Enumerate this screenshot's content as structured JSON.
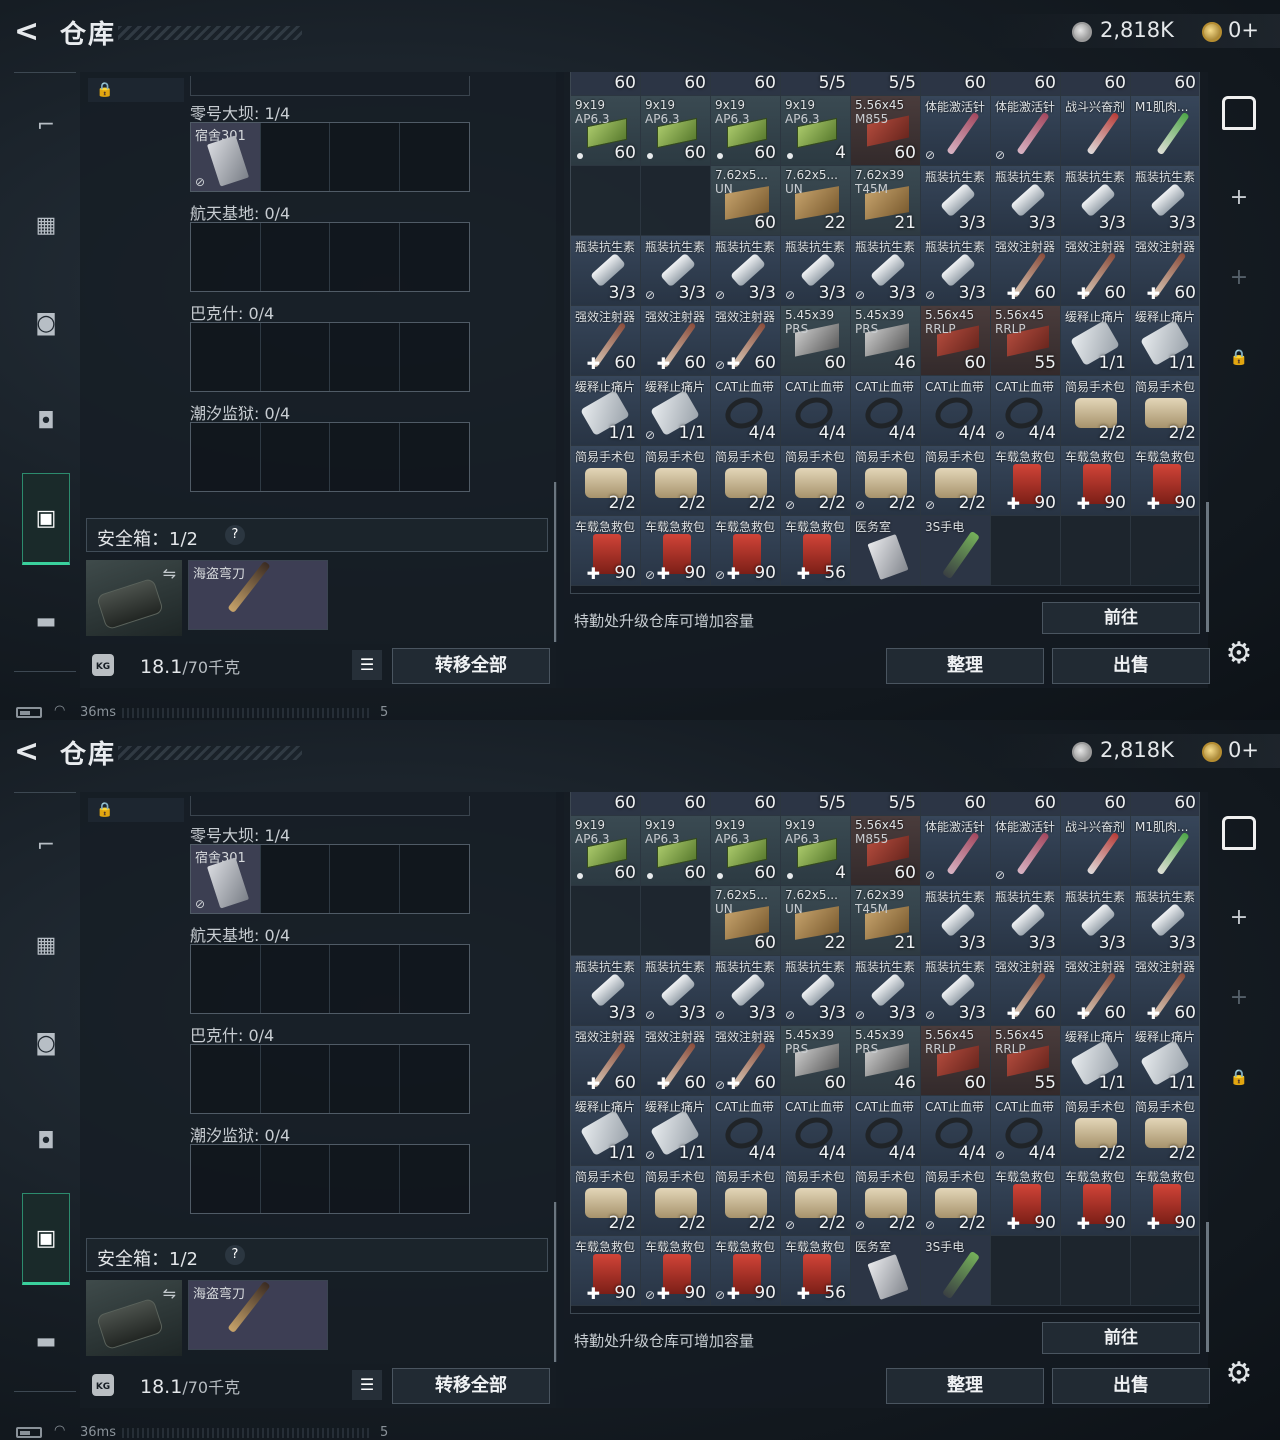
{
  "window": {
    "title": "仓库"
  },
  "currency": {
    "silver": "2,818K",
    "gold": "0+"
  },
  "nav_left": [
    {
      "icon": "pistol-icon",
      "glyph": "⌐"
    },
    {
      "icon": "vest-icon",
      "glyph": "▦"
    },
    {
      "icon": "backpack-icon",
      "glyph": "◙"
    },
    {
      "icon": "bag-icon",
      "glyph": "◘"
    },
    {
      "icon": "safebox-icon",
      "glyph": "▣"
    },
    {
      "icon": "briefcase-icon",
      "glyph": "▬"
    }
  ],
  "maps": [
    {
      "label": "零号大坝: 1/4",
      "items": [
        {
          "name": "宿舍301",
          "nosell": true
        }
      ]
    },
    {
      "label": "航天基地: 0/4",
      "items": []
    },
    {
      "label": "巴克什: 0/4",
      "items": []
    },
    {
      "label": "潮汐监狱: 0/4",
      "items": []
    }
  ],
  "safebox": {
    "title": "安全箱：1/2",
    "help": "?",
    "slot_item": "海盗弯刀"
  },
  "capacity": {
    "weight": "18.1",
    "max": "/70千克",
    "kg_label": "KG"
  },
  "actions": {
    "transfer_all": "转移全部",
    "goto": "前往",
    "sort": "整理",
    "sell": "出售",
    "list_icon": "☰"
  },
  "upgrade_hint": "特勤处升级仓库可增加容量",
  "status": {
    "ping": "36ms",
    "num": "5"
  },
  "stash_top_counts": [
    "60",
    "60",
    "60",
    "5/5",
    "5/5",
    "60",
    "60",
    "60",
    "60"
  ],
  "stash": [
    [
      {
        "n": "9x19",
        "s": "AP6.3",
        "c": "60",
        "t": "ammo-green",
        "i": "box-green",
        "dot": true
      },
      {
        "n": "9x19",
        "s": "AP6.3",
        "c": "60",
        "t": "ammo-green",
        "i": "box-green",
        "dot": true
      },
      {
        "n": "9x19",
        "s": "AP6.3",
        "c": "60",
        "t": "ammo-green",
        "i": "box-green",
        "dot": true
      },
      {
        "n": "9x19",
        "s": "AP6.3",
        "c": "4",
        "t": "ammo-green",
        "i": "box-green",
        "dot": true
      },
      {
        "n": "5.56x45",
        "s": "M855",
        "c": "60",
        "t": "ammo-red",
        "i": "box-red"
      },
      {
        "n": "体能激活针",
        "s": "",
        "c": "",
        "t": "med",
        "i": "pen-pink",
        "ns": true
      },
      {
        "n": "体能激活针",
        "s": "",
        "c": "",
        "t": "med",
        "i": "pen-pink",
        "ns": true
      },
      {
        "n": "战斗兴奋剂",
        "s": "",
        "c": "",
        "t": "med",
        "i": "pen-red"
      },
      {
        "n": "M1肌肉...",
        "s": "",
        "c": "",
        "t": "med",
        "i": "pen-green"
      }
    ],
    [
      {
        "n": "",
        "s": "",
        "c": "",
        "t": "empty",
        "i": ""
      },
      {
        "n": "",
        "s": "",
        "c": "",
        "t": "empty",
        "i": ""
      },
      {
        "n": "7.62x5...",
        "s": "UN",
        "c": "60",
        "t": "ammo-tan",
        "i": "box-tan"
      },
      {
        "n": "7.62x5...",
        "s": "UN",
        "c": "22",
        "t": "ammo-tan",
        "i": "box-tan"
      },
      {
        "n": "7.62x39",
        "s": "T45M",
        "c": "21",
        "t": "ammo-tan",
        "i": "box-tan"
      },
      {
        "n": "瓶装抗生素",
        "s": "",
        "c": "3/3",
        "t": "med",
        "i": "vial"
      },
      {
        "n": "瓶装抗生素",
        "s": "",
        "c": "3/3",
        "t": "med",
        "i": "vial"
      },
      {
        "n": "瓶装抗生素",
        "s": "",
        "c": "3/3",
        "t": "med",
        "i": "vial"
      },
      {
        "n": "瓶装抗生素",
        "s": "",
        "c": "3/3",
        "t": "med",
        "i": "vial"
      }
    ],
    [
      {
        "n": "瓶装抗生素",
        "s": "",
        "c": "3/3",
        "t": "med",
        "i": "vial"
      },
      {
        "n": "瓶装抗生素",
        "s": "",
        "c": "3/3",
        "t": "med",
        "i": "vial",
        "ns": true
      },
      {
        "n": "瓶装抗生素",
        "s": "",
        "c": "3/3",
        "t": "med",
        "i": "vial",
        "ns": true
      },
      {
        "n": "瓶装抗生素",
        "s": "",
        "c": "3/3",
        "t": "med",
        "i": "vial",
        "ns": true
      },
      {
        "n": "瓶装抗生素",
        "s": "",
        "c": "3/3",
        "t": "med",
        "i": "vial",
        "ns": true
      },
      {
        "n": "瓶装抗生素",
        "s": "",
        "c": "3/3",
        "t": "med",
        "i": "vial",
        "ns": true
      },
      {
        "n": "强效注射器",
        "s": "",
        "c": "60",
        "t": "med",
        "i": "syringe",
        "plus": true
      },
      {
        "n": "强效注射器",
        "s": "",
        "c": "60",
        "t": "med",
        "i": "syringe",
        "plus": true
      },
      {
        "n": "强效注射器",
        "s": "",
        "c": "60",
        "t": "med",
        "i": "syringe",
        "plus": true
      }
    ],
    [
      {
        "n": "强效注射器",
        "s": "",
        "c": "60",
        "t": "med",
        "i": "syringe",
        "plus": true
      },
      {
        "n": "强效注射器",
        "s": "",
        "c": "60",
        "t": "med",
        "i": "syringe",
        "plus": true
      },
      {
        "n": "强效注射器",
        "s": "",
        "c": "60",
        "t": "med",
        "i": "syringe",
        "plus": true,
        "ns": true
      },
      {
        "n": "5.45x39",
        "s": "PRS",
        "c": "60",
        "t": "ammo-tan",
        "i": "box-gray"
      },
      {
        "n": "5.45x39",
        "s": "PRS",
        "c": "46",
        "t": "ammo-tan",
        "i": "box-gray"
      },
      {
        "n": "5.56x45",
        "s": "RRLP",
        "c": "60",
        "t": "ammo-red",
        "i": "box-red"
      },
      {
        "n": "5.56x45",
        "s": "RRLP",
        "c": "55",
        "t": "ammo-red",
        "i": "box-red"
      },
      {
        "n": "缓释止痛片",
        "s": "",
        "c": "1/1",
        "t": "med",
        "i": "pills"
      },
      {
        "n": "缓释止痛片",
        "s": "",
        "c": "1/1",
        "t": "med",
        "i": "pills"
      }
    ],
    [
      {
        "n": "缓释止痛片",
        "s": "",
        "c": "1/1",
        "t": "med",
        "i": "pills"
      },
      {
        "n": "缓释止痛片",
        "s": "",
        "c": "1/1",
        "t": "med",
        "i": "pills",
        "ns": true
      },
      {
        "n": "CAT止血带",
        "s": "",
        "c": "4/4",
        "t": "med",
        "i": "tourniquet"
      },
      {
        "n": "CAT止血带",
        "s": "",
        "c": "4/4",
        "t": "med",
        "i": "tourniquet"
      },
      {
        "n": "CAT止血带",
        "s": "",
        "c": "4/4",
        "t": "med",
        "i": "tourniquet"
      },
      {
        "n": "CAT止血带",
        "s": "",
        "c": "4/4",
        "t": "med",
        "i": "tourniquet"
      },
      {
        "n": "CAT止血带",
        "s": "",
        "c": "4/4",
        "t": "med",
        "i": "tourniquet",
        "ns": true
      },
      {
        "n": "简易手术包",
        "s": "",
        "c": "2/2",
        "t": "med",
        "i": "surgical"
      },
      {
        "n": "简易手术包",
        "s": "",
        "c": "2/2",
        "t": "med",
        "i": "surgical"
      }
    ],
    [
      {
        "n": "简易手术包",
        "s": "",
        "c": "2/2",
        "t": "med",
        "i": "surgical"
      },
      {
        "n": "简易手术包",
        "s": "",
        "c": "2/2",
        "t": "med",
        "i": "surgical"
      },
      {
        "n": "简易手术包",
        "s": "",
        "c": "2/2",
        "t": "med",
        "i": "surgical"
      },
      {
        "n": "简易手术包",
        "s": "",
        "c": "2/2",
        "t": "med",
        "i": "surgical",
        "ns": true
      },
      {
        "n": "简易手术包",
        "s": "",
        "c": "2/2",
        "t": "med",
        "i": "surgical",
        "ns": true
      },
      {
        "n": "简易手术包",
        "s": "",
        "c": "2/2",
        "t": "med",
        "i": "surgical",
        "ns": true
      },
      {
        "n": "车载急救包",
        "s": "",
        "c": "90",
        "t": "med",
        "i": "redkit",
        "plus": true
      },
      {
        "n": "车载急救包",
        "s": "",
        "c": "90",
        "t": "med",
        "i": "redkit",
        "plus": true
      },
      {
        "n": "车载急救包",
        "s": "",
        "c": "90",
        "t": "med",
        "i": "redkit",
        "plus": true
      }
    ],
    [
      {
        "n": "车载急救包",
        "s": "",
        "c": "90",
        "t": "med",
        "i": "redkit",
        "plus": true
      },
      {
        "n": "车载急救包",
        "s": "",
        "c": "90",
        "t": "med",
        "i": "redkit",
        "plus": true,
        "ns": true
      },
      {
        "n": "车载急救包",
        "s": "",
        "c": "90",
        "t": "med",
        "i": "redkit",
        "plus": true,
        "ns": true
      },
      {
        "n": "车载急救包",
        "s": "",
        "c": "56",
        "t": "med",
        "i": "redkit",
        "plus": true
      },
      {
        "n": "医务室",
        "s": "",
        "c": "",
        "t": "dark",
        "i": "cardwhite"
      },
      {
        "n": "3S手电",
        "s": "",
        "c": "",
        "t": "dark",
        "i": "flashlight"
      },
      {
        "n": "",
        "s": "",
        "c": "",
        "t": "empty",
        "i": ""
      },
      {
        "n": "",
        "s": "",
        "c": "",
        "t": "empty",
        "i": ""
      },
      {
        "n": "",
        "s": "",
        "c": "",
        "t": "empty",
        "i": ""
      }
    ]
  ]
}
